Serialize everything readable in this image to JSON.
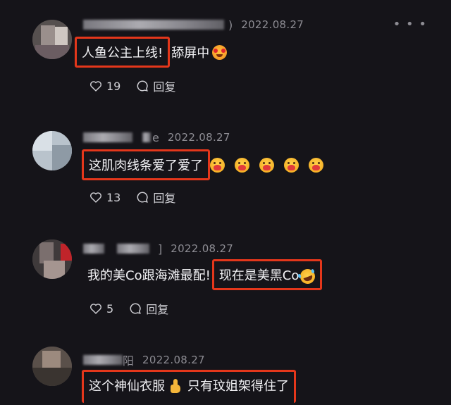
{
  "colors": {
    "background": "#151419",
    "highlight_box": "#e4371b",
    "text": "#f2f2f5",
    "meta_text": "#8d8c93"
  },
  "more_icon": "more-icon",
  "comments": [
    {
      "name_tail": ")",
      "date": "2022.08.27",
      "text_highlighted": "人鱼公主上线!",
      "text_after": "舔屏中",
      "emoji": "star-struck-emoji",
      "like_count": "19",
      "reply_label": "回复"
    },
    {
      "name_tail": "e",
      "date": "2022.08.27",
      "text_highlighted": "这肌肉线条爱了爱了",
      "emoji": "hugging-face-emoji",
      "like_count": "13",
      "reply_label": "回复"
    },
    {
      "name_tail": "]",
      "date": "2022.08.27",
      "text_before": "我的美Co跟海滩最配!",
      "text_highlighted": "现在是美黑Co",
      "emoji": "rolling-laughing-emoji",
      "like_count": "5",
      "reply_label": "回复"
    },
    {
      "name_tail": "阳",
      "date": "2022.08.27",
      "text_highlighted": "这个神仙衣服",
      "emoji": "thumbs-up-emoji",
      "text_after": "只有玟姐架得住了"
    }
  ]
}
